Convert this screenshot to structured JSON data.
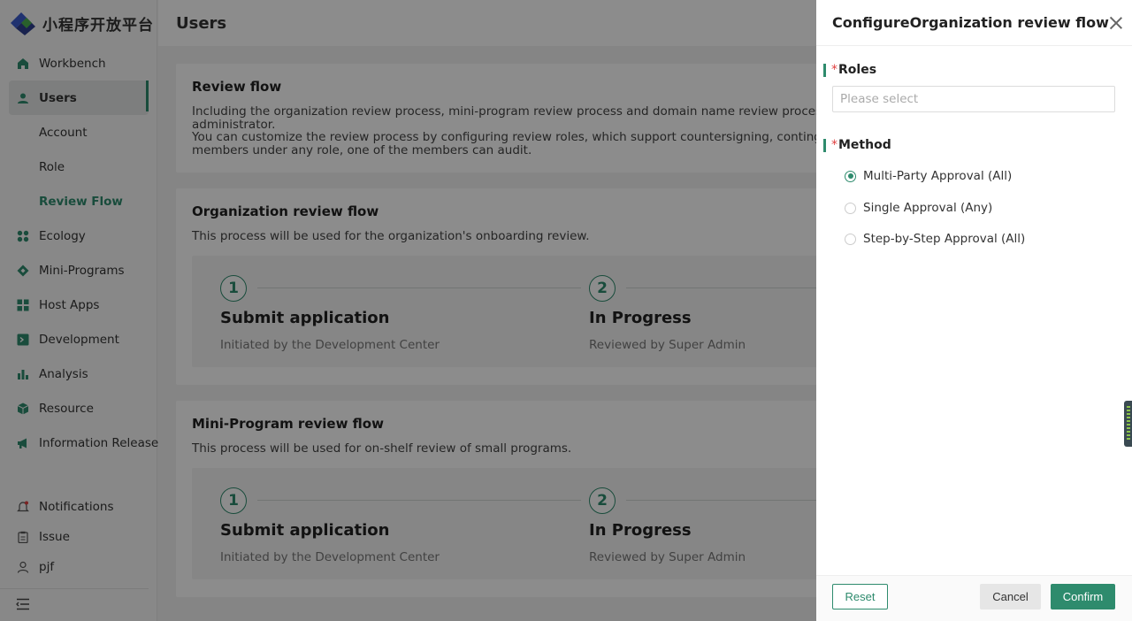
{
  "app": {
    "logo_text": "小程序开放平台",
    "accent": "#2e8b6d"
  },
  "sidebar": {
    "items": [
      {
        "label": "Workbench",
        "icon": "home-icon"
      },
      {
        "label": "Users",
        "icon": "user-icon",
        "active": true
      },
      {
        "label": "Account"
      },
      {
        "label": "Role"
      },
      {
        "label": "Review Flow",
        "selected": true
      },
      {
        "label": "Ecology",
        "icon": "grid-icon"
      },
      {
        "label": "Mini-Programs",
        "icon": "diamond-icon"
      },
      {
        "label": "Host Apps",
        "icon": "apps-icon"
      },
      {
        "label": "Development",
        "icon": "terminal-icon"
      },
      {
        "label": "Analysis",
        "icon": "bar-chart-icon"
      },
      {
        "label": "Resource",
        "icon": "cube-icon"
      },
      {
        "label": "Information Release",
        "icon": "megaphone-icon"
      }
    ],
    "bottom": [
      {
        "label": "Notifications",
        "icon": "bell-icon"
      },
      {
        "label": "Issue",
        "icon": "clipboard-icon"
      },
      {
        "label": "pjf",
        "icon": "person-icon"
      }
    ]
  },
  "header": {
    "title": "Users"
  },
  "main": {
    "review_flow": {
      "title": "Review flow",
      "line1": "Including the organization review process, mini-program review process and domain name review process, the default",
      "line2": "administrator.",
      "line3": "You can customize the review process by configuring review roles, which support countersigning, contingent signing a",
      "line4": "members under any role, one of the members can audit."
    },
    "org_flow": {
      "title": "Organization review flow",
      "desc": "This process will be used for the organization's onboarding review.",
      "steps": [
        {
          "num": "1",
          "title": "Submit application",
          "desc": "Initiated by the Development Center"
        },
        {
          "num": "2",
          "title": "In Progress",
          "desc": "Reviewed by Super Admin"
        }
      ]
    },
    "mini_flow": {
      "title": "Mini-Program review flow",
      "desc": "This process will be used for on-shelf review of small programs.",
      "steps": [
        {
          "num": "1",
          "title": "Submit application",
          "desc": "Initiated by the Development Center"
        },
        {
          "num": "2",
          "title": "In Progress",
          "desc": "Reviewed by Super Admin"
        }
      ]
    }
  },
  "drawer": {
    "title": "ConfigureOrganization review flow",
    "roles_label": "Roles",
    "roles_placeholder": "Please select",
    "method_label": "Method",
    "required_mark": "*",
    "methods": [
      {
        "label": "Multi-Party Approval (All)",
        "checked": true
      },
      {
        "label": "Single Approval (Any)",
        "checked": false
      },
      {
        "label": "Step-by-Step Approval (All)",
        "checked": false
      }
    ],
    "reset_label": "Reset",
    "cancel_label": "Cancel",
    "confirm_label": "Confirm"
  }
}
